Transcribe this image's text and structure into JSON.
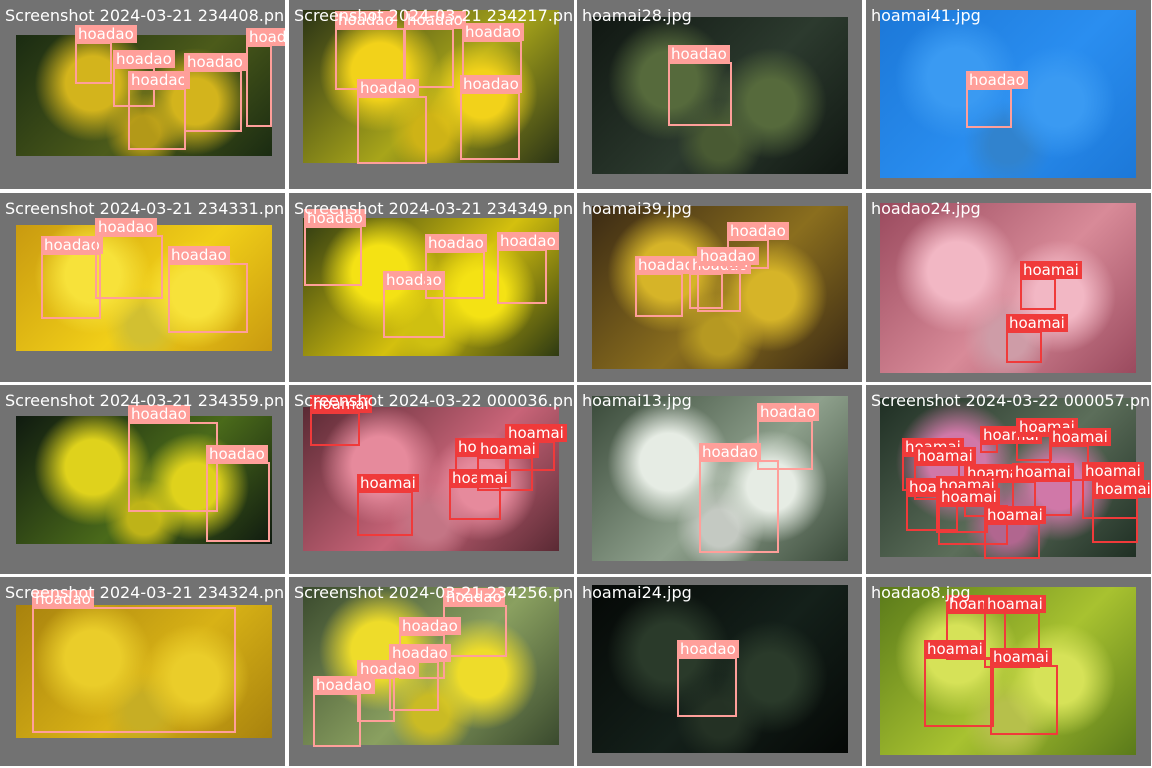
{
  "classes": {
    "hoadao": {
      "color": "#ff9f9a"
    },
    "hoamai": {
      "color": "#f03a3a"
    }
  },
  "tiles": [
    {
      "file": "Screenshot 2024-03-21 234408.png",
      "bg": [
        "#1a2b12",
        "#4c5b1a",
        "#d3b41c"
      ],
      "boxes": [
        {
          "cls": "hoadao",
          "text": "hoadao"
        },
        {
          "cls": "hoadao",
          "text": "hoadao"
        },
        {
          "cls": "hoadao",
          "text": "hoadao"
        },
        {
          "cls": "hoadao",
          "text": "hoadao"
        },
        {
          "cls": "hoadao",
          "text": "hoadao"
        }
      ]
    },
    {
      "file": "Screenshot 2024-03-21 234217.png",
      "bg": [
        "#2b3416",
        "#a8a51a",
        "#f2d21a"
      ],
      "boxes": [
        {
          "cls": "hoadao",
          "text": "hoadao"
        },
        {
          "cls": "hoadao",
          "text": "hoadao"
        },
        {
          "cls": "hoadao",
          "text": "hoadao"
        },
        {
          "cls": "hoadao",
          "text": "hoadao"
        },
        {
          "cls": "hoadao",
          "text": "hoadao"
        }
      ]
    },
    {
      "file": "hoamai28.jpg",
      "bg": [
        "#101712",
        "#2c3a2e",
        "#566a3c"
      ],
      "boxes": [
        {
          "cls": "hoadao",
          "text": "hoadao"
        }
      ]
    },
    {
      "file": "hoamai41.jpg",
      "bg": [
        "#1c78d8",
        "#2a8ef0",
        "#3a9af2"
      ],
      "boxes": [
        {
          "cls": "hoadao",
          "text": "hoadao"
        }
      ]
    },
    {
      "file": "Screenshot 2024-03-21 234331.png",
      "bg": [
        "#c99a10",
        "#f1cf18",
        "#f7e23a"
      ],
      "boxes": [
        {
          "cls": "hoadao",
          "text": "hoadao"
        },
        {
          "cls": "hoadao",
          "text": "hoadao"
        },
        {
          "cls": "hoadao",
          "text": "hoadao"
        }
      ]
    },
    {
      "file": "Screenshot 2024-03-21 234349.png",
      "bg": [
        "#2e3a12",
        "#d4c00e",
        "#f4e214"
      ],
      "boxes": [
        {
          "cls": "hoadao",
          "text": "hoadao"
        },
        {
          "cls": "hoadao",
          "text": "hoadao"
        },
        {
          "cls": "hoadao",
          "text": "hoadao"
        },
        {
          "cls": "hoadao",
          "text": "hoadao"
        }
      ]
    },
    {
      "file": "hoamai39.jpg",
      "bg": [
        "#3b2a14",
        "#8a6e1e",
        "#d6b428"
      ],
      "boxes": [
        {
          "cls": "hoadao",
          "text": "hoadao"
        },
        {
          "cls": "hoadao",
          "text": "hoadao"
        },
        {
          "cls": "hoadao",
          "text": "hoadao"
        },
        {
          "cls": "hoadao",
          "text": "hoadao"
        }
      ]
    },
    {
      "file": "hoadao24.jpg",
      "bg": [
        "#9a4a5e",
        "#d88a98",
        "#f2b7c4"
      ],
      "boxes": [
        {
          "cls": "hoamai",
          "text": "hoamai"
        },
        {
          "cls": "hoamai",
          "text": "hoamai"
        }
      ]
    },
    {
      "file": "Screenshot 2024-03-21 234359.png",
      "bg": [
        "#0f1a10",
        "#4a6a1a",
        "#dfd21c"
      ],
      "boxes": [
        {
          "cls": "hoadao",
          "text": "hoadao"
        },
        {
          "cls": "hoadao",
          "text": "hoadao"
        }
      ]
    },
    {
      "file": "Screenshot 2024-03-22 000036.png",
      "bg": [
        "#5a2a34",
        "#c86478",
        "#e68a9c"
      ],
      "boxes": [
        {
          "cls": "hoamai",
          "text": "hoamai"
        },
        {
          "cls": "hoamai",
          "text": "hoamai"
        },
        {
          "cls": "hoamai",
          "text": "hoamai"
        },
        {
          "cls": "hoamai",
          "text": "hoamai"
        },
        {
          "cls": "hoamai",
          "text": "hoamai"
        },
        {
          "cls": "hoamai",
          "text": "hoamai"
        }
      ]
    },
    {
      "file": "hoamai13.jpg",
      "bg": [
        "#3a4a3a",
        "#8ea08c",
        "#e6ece4"
      ],
      "boxes": [
        {
          "cls": "hoadao",
          "text": "hoadao"
        },
        {
          "cls": "hoadao",
          "text": "hoadao"
        }
      ]
    },
    {
      "file": "Screenshot 2024-03-22 000057.png",
      "bg": [
        "#1f2f24",
        "#5c6e5a",
        "#d078a8"
      ],
      "boxes": [
        {
          "cls": "hoamai",
          "text": "hoamai"
        },
        {
          "cls": "hoamai",
          "text": "hoamai"
        },
        {
          "cls": "hoamai",
          "text": "hoamai"
        },
        {
          "cls": "hoamai",
          "text": "hoamai"
        },
        {
          "cls": "hoamai",
          "text": "hoamai"
        },
        {
          "cls": "hoamai",
          "text": "hoamai"
        },
        {
          "cls": "hoamai",
          "text": "hoamai"
        },
        {
          "cls": "hoamai",
          "text": "hoamai"
        },
        {
          "cls": "hoamai",
          "text": "hoamai"
        },
        {
          "cls": "hoamai",
          "text": "hoamai"
        },
        {
          "cls": "hoamai",
          "text": "hoamai"
        },
        {
          "cls": "hoamai",
          "text": "hoamai"
        },
        {
          "cls": "hoamai",
          "text": "hoamai"
        }
      ]
    },
    {
      "file": "Screenshot 2024-03-21 234324.png",
      "bg": [
        "#a8820e",
        "#d8b216",
        "#eacd2a"
      ],
      "boxes": [
        {
          "cls": "hoadao",
          "text": "hoadao"
        }
      ]
    },
    {
      "file": "Screenshot 2024-03-21 234256.png",
      "bg": [
        "#3a4a2e",
        "#8aa060",
        "#eedc2a"
      ],
      "boxes": [
        {
          "cls": "hoadao",
          "text": "hoadao"
        },
        {
          "cls": "hoadao",
          "text": "hoadao"
        },
        {
          "cls": "hoadao",
          "text": "hoadao"
        },
        {
          "cls": "hoadao",
          "text": "hoadao"
        },
        {
          "cls": "hoadao",
          "text": "hoadao"
        }
      ]
    },
    {
      "file": "hoamai24.jpg",
      "bg": [
        "#050806",
        "#14201a",
        "#2a3a2a"
      ],
      "boxes": [
        {
          "cls": "hoadao",
          "text": "hoadao"
        }
      ]
    },
    {
      "file": "hoadao8.jpg",
      "bg": [
        "#5a7a1a",
        "#a8c230",
        "#d6e258"
      ],
      "boxes": [
        {
          "cls": "hoamai",
          "text": "hoamai"
        },
        {
          "cls": "hoamai",
          "text": "hoamai"
        },
        {
          "cls": "hoamai",
          "text": "hoamai"
        },
        {
          "cls": "hoamai",
          "text": "hoamai"
        }
      ]
    }
  ]
}
